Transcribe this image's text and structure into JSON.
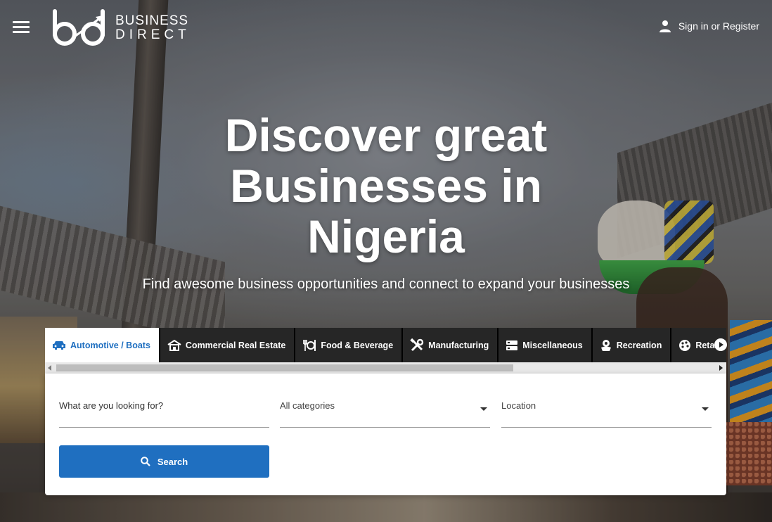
{
  "header": {
    "logo_line1": "BUSINESS",
    "logo_line2": "DIRECT",
    "signin_label": "Sign in or Register"
  },
  "hero": {
    "headline_line1": "Discover great",
    "headline_line2": "Businesses in",
    "headline_line3": "Nigeria",
    "subline": "Find awesome business opportunities and connect to expand your businesses"
  },
  "tabs": [
    {
      "label": "Automotive / Boats",
      "icon": "car-icon",
      "active": true
    },
    {
      "label": "Commercial Real Estate",
      "icon": "building-icon",
      "active": false
    },
    {
      "label": "Food & Beverage",
      "icon": "food-icon",
      "active": false
    },
    {
      "label": "Manufacturing",
      "icon": "tools-icon",
      "active": false
    },
    {
      "label": "Miscellaneous",
      "icon": "server-icon",
      "active": false
    },
    {
      "label": "Recreation",
      "icon": "flower-icon",
      "active": false
    },
    {
      "label": "Retail",
      "icon": "palette-icon",
      "active": false
    }
  ],
  "search": {
    "keyword_placeholder": "What are you looking for?",
    "category_value": "All categories",
    "location_value": "Location",
    "button_label": "Search"
  },
  "colors": {
    "accent": "#1f6fc0",
    "tab_bar": "#222222"
  }
}
